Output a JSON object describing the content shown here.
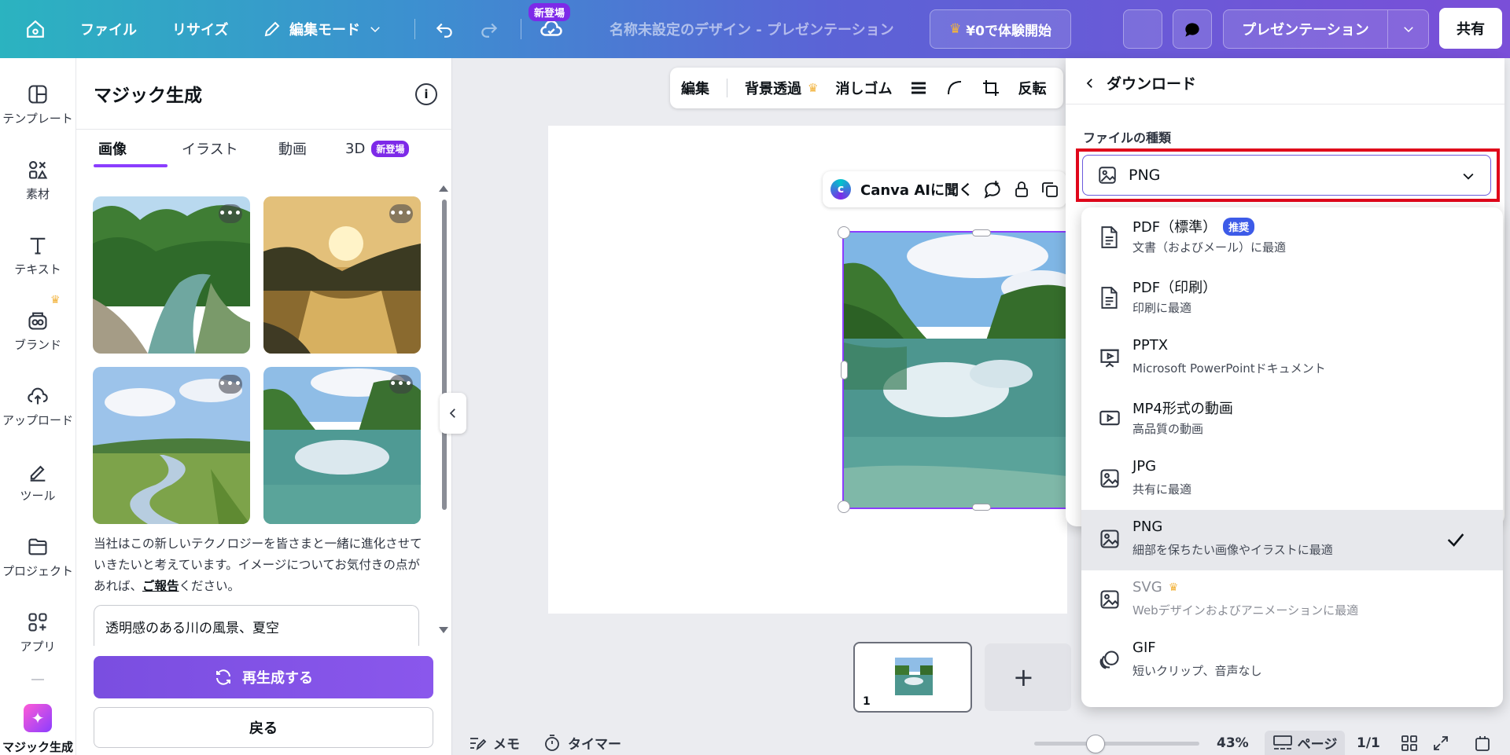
{
  "topbar": {
    "file": "ファイル",
    "resize": "リサイズ",
    "edit_mode": "編集モード",
    "new_badge": "新登場",
    "doc_title": "名称未設定のデザイン - プレゼンテーション",
    "trial": "¥0で体験開始",
    "present": "プレゼンテーション",
    "share": "共有"
  },
  "rail": {
    "items": [
      {
        "label": "テンプレート",
        "icon": "template-icon"
      },
      {
        "label": "素材",
        "icon": "elements-icon"
      },
      {
        "label": "テキスト",
        "icon": "text-icon"
      },
      {
        "label": "ブランド",
        "icon": "brand-icon"
      },
      {
        "label": "アップロード",
        "icon": "upload-icon"
      },
      {
        "label": "ツール",
        "icon": "tools-icon"
      },
      {
        "label": "プロジェクト",
        "icon": "folder-icon"
      },
      {
        "label": "アプリ",
        "icon": "apps-icon"
      },
      {
        "label": "マジック生成",
        "icon": "magic-icon"
      }
    ]
  },
  "panel": {
    "title": "マジック生成",
    "tabs": [
      "画像",
      "イラスト",
      "動画",
      "3D"
    ],
    "tab_badge": "新登場",
    "feedback_before": "当社はこの新しいテクノロジーを皆さまと一緒に進化させていきたいと考えています。イメージについてお気付きの点があれば、",
    "feedback_link": "ご報告",
    "feedback_after": "ください。",
    "prompt": "透明感のある川の風景、夏空",
    "regenerate": "再生成する",
    "back": "戻る"
  },
  "image_toolbar": {
    "edit": "編集",
    "bg_remove": "背景透過",
    "eraser": "消しゴム",
    "flip": "反転"
  },
  "ai_bar": {
    "label": "Canva AIに聞く"
  },
  "pages": {
    "current": "1"
  },
  "footer": {
    "notes": "メモ",
    "timer": "タイマー",
    "zoom": "43%",
    "zoom_level": 0.43,
    "pages_label": "ページ",
    "page_count": "1/1"
  },
  "download": {
    "header": "ダウンロード",
    "file_type_label": "ファイルの種類",
    "selected_type": "PNG",
    "recommended": "推奨",
    "options": [
      {
        "title": "PDF（標準）",
        "desc": "文書（およびメール）に最適",
        "icon": "document-icon"
      },
      {
        "title": "PDF（印刷）",
        "desc": "印刷に最適",
        "icon": "document-print-icon"
      },
      {
        "title": "PPTX",
        "desc": "Microsoft PowerPointドキュメント",
        "icon": "presentation-icon"
      },
      {
        "title": "MP4形式の動画",
        "desc": "高品質の動画",
        "icon": "video-icon"
      },
      {
        "title": "JPG",
        "desc": "共有に最適",
        "icon": "image-icon"
      },
      {
        "title": "PNG",
        "desc": "細部を保ちたい画像やイラストに最適",
        "icon": "image-icon"
      },
      {
        "title": "SVG",
        "desc": "Webデザインおよびアニメーションに最適",
        "icon": "image-icon"
      },
      {
        "title": "GIF",
        "desc": "短いクリップ、音声なし",
        "icon": "gif-icon"
      }
    ]
  },
  "colors": {
    "accent": "#8b3dff",
    "highlight": "#e0071b",
    "crown": "#f2b33d"
  }
}
